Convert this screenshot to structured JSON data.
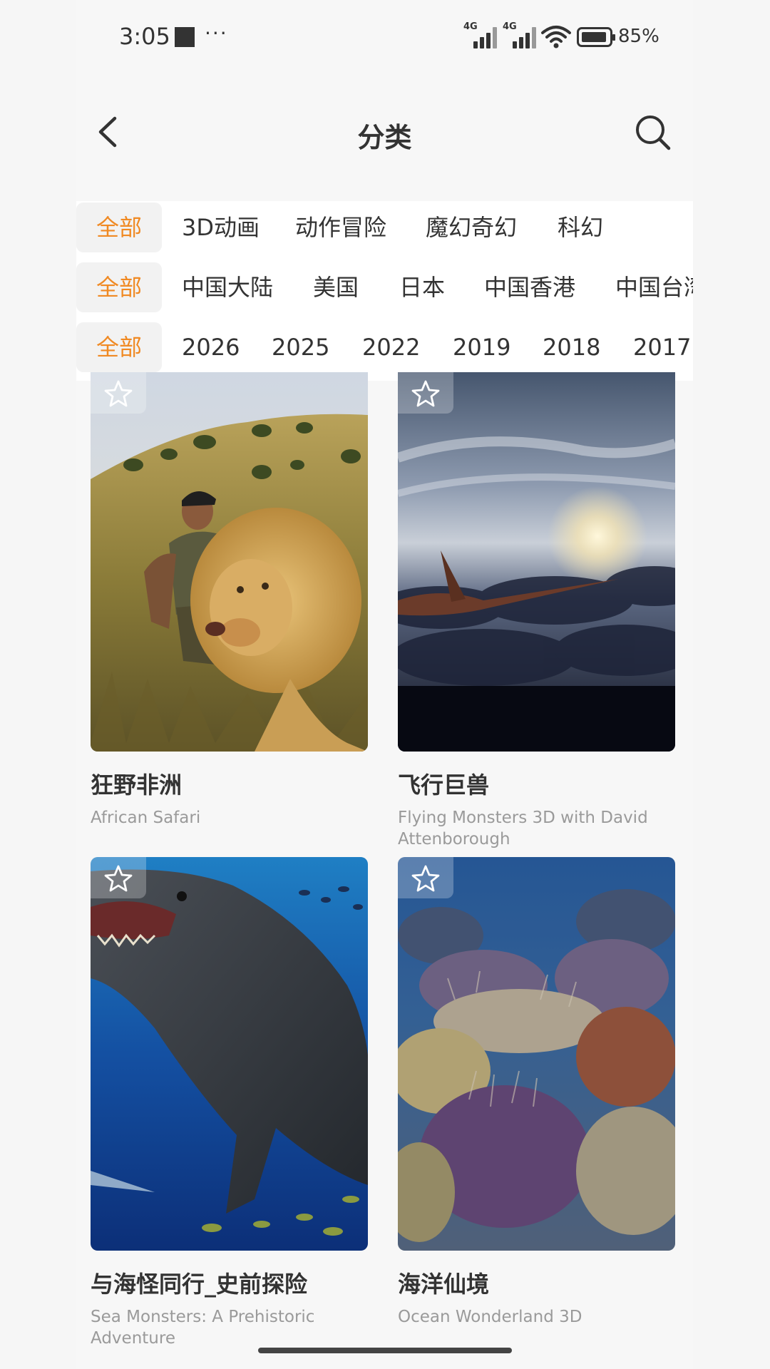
{
  "status_bar": {
    "time": "3:05",
    "dots": "···",
    "net1": "4G",
    "net2": "4G",
    "battery": "85%"
  },
  "header": {
    "title": "分类"
  },
  "filters": {
    "genre": {
      "active": "全部",
      "options": [
        "3D动画",
        "动作冒险",
        "魔幻奇幻",
        "科幻"
      ]
    },
    "region": {
      "active": "全部",
      "options": [
        "中国大陆",
        "美国",
        "日本",
        "中国香港",
        "中国台湾"
      ]
    },
    "year": {
      "active": "全部",
      "options": [
        "2026",
        "2025",
        "2022",
        "2019",
        "2018",
        "2017"
      ]
    }
  },
  "movies": [
    {
      "title": "狂野非洲",
      "subtitle": "African Safari"
    },
    {
      "title": "飞行巨兽",
      "subtitle": "Flying Monsters 3D with David Attenborough"
    },
    {
      "title": "与海怪同行_史前探险",
      "subtitle": "Sea Monsters: A Prehistoric Adventure"
    },
    {
      "title": "海洋仙境",
      "subtitle": "Ocean Wonderland 3D"
    }
  ],
  "icons": [
    "back-arrow-icon",
    "search-icon",
    "star-icon",
    "wifi-icon",
    "battery-icon",
    "signal-icon"
  ]
}
